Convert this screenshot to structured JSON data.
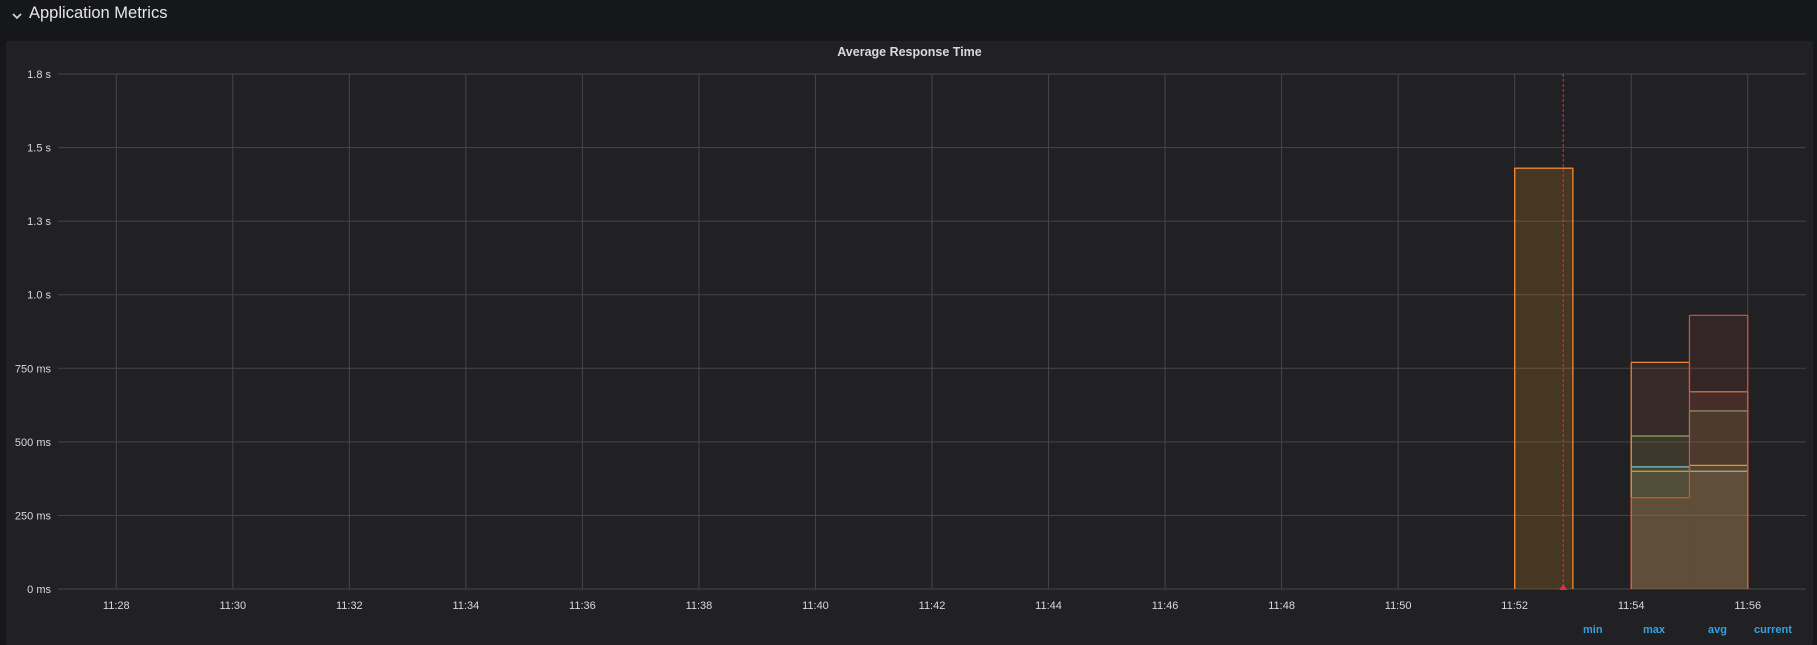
{
  "row": {
    "title": "Application Metrics",
    "chevron_icon": "chevron-down-icon"
  },
  "panel": {
    "title": "Average Response Time",
    "legend_columns": [
      "min",
      "max",
      "avg",
      "current"
    ]
  },
  "colors": {
    "background": "#161719",
    "panel": "#212124",
    "grid": "#464649",
    "axis_text": "#d8d9da",
    "legend_link": "#33a2e5",
    "annotation": "#e02f44"
  },
  "chart_data": {
    "type": "area",
    "title": "Average Response Time",
    "xlabel": "",
    "ylabel": "",
    "x_ticks": [
      "11:28",
      "11:30",
      "11:32",
      "11:34",
      "11:36",
      "11:38",
      "11:40",
      "11:42",
      "11:44",
      "11:46",
      "11:48",
      "11:50",
      "11:52",
      "11:54",
      "11:56"
    ],
    "y_ticks": [
      "0 ms",
      "250 ms",
      "500 ms",
      "750 ms",
      "1.0 s",
      "1.3 s",
      "1.5 s",
      "1.8 s"
    ],
    "ylim_ms": [
      0,
      1750
    ],
    "x_range": [
      "11:27",
      "11:57"
    ],
    "grid": true,
    "stepped": true,
    "series": [
      {
        "color": "#e5ac0e",
        "points": [
          [
            "11:52",
            1430
          ],
          [
            "11:53",
            null
          ],
          [
            "11:54",
            400
          ],
          [
            "11:55",
            420
          ]
        ]
      },
      {
        "color": "#6ed0e0",
        "points": [
          [
            "11:54",
            415
          ],
          [
            "11:55",
            400
          ]
        ]
      },
      {
        "color": "#7eb26d",
        "points": [
          [
            "11:54",
            520
          ],
          [
            "11:55",
            605
          ]
        ]
      },
      {
        "color": "#ef843c",
        "points": [
          [
            "11:52",
            1430
          ],
          [
            "11:53",
            null
          ],
          [
            "11:54",
            770
          ],
          [
            "11:55",
            670
          ]
        ]
      },
      {
        "color": "#e24d42",
        "points": [
          [
            "11:54",
            310
          ],
          [
            "11:55",
            930
          ]
        ]
      }
    ],
    "annotations": [
      {
        "time": "11:52:50",
        "color": "#e02f44"
      }
    ]
  }
}
